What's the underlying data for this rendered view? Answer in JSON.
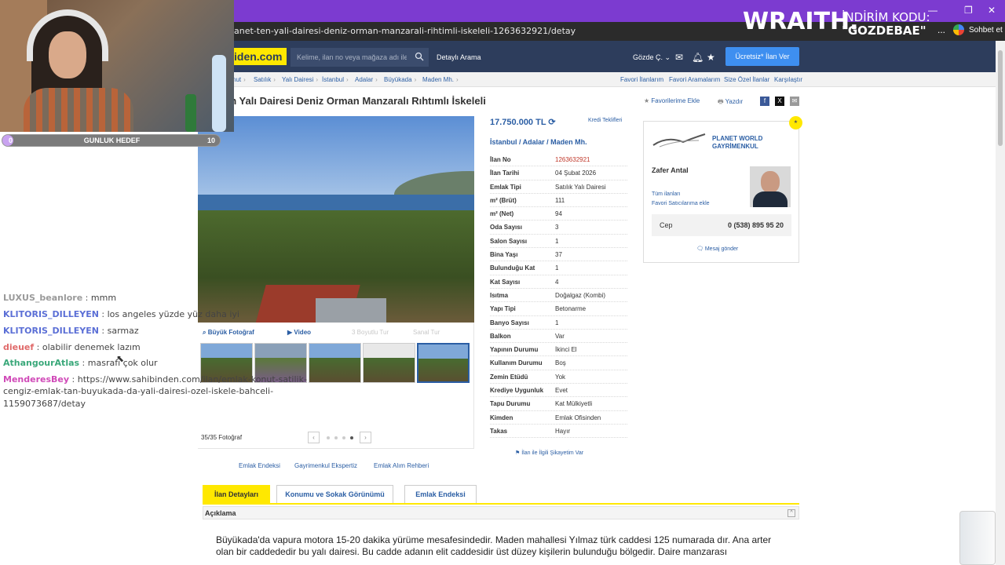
{
  "browser": {
    "url": "anet-ten-yali-dairesi-deniz-orman-manzarali-rihtimli-iskeleli-1263632921/detay",
    "more_label": "...",
    "chat_label": "Sohbet et"
  },
  "promo": {
    "brand": "WRAITH.",
    "line1": "İNDİRİM KODU:",
    "line2": "\"GOZDEBAE\""
  },
  "site": {
    "logo": "iden.com",
    "search_placeholder": "Kelime, ilan no veya mağaza adı ile ara",
    "advanced_search": "Detaylı Arama",
    "user_name": "Gözde Ç.",
    "post_button": "Ücretsiz* İlan Ver"
  },
  "breadcrumbs": [
    "nut",
    "Satılık",
    "Yalı Dairesi",
    "İstanbul",
    "Adalar",
    "Büyükada",
    "Maden Mh."
  ],
  "right_links": [
    "Favori İlanlarım",
    "Favori Aramalarım",
    "Size Özel İlanlar",
    "Karşılaştır"
  ],
  "listing": {
    "title": "en Yalı Dairesi Deniz Orman Manzaralı Rıhtımlı İskeleli",
    "favorite": "Favorilerime Ekle",
    "print": "Yazdır",
    "price": "17.750.000 TL",
    "loan": "Kredi Teklifleri",
    "location": "İstanbul  /  Adalar  /  Maden Mh.",
    "complain": "İlan ile İlgili Şikayetim Var"
  },
  "photo_bar": {
    "big_photo": "Büyük Fotoğraf",
    "video": "Video",
    "disabled1": "3 Boyutlu Tur",
    "disabled2": "Sanal Tur",
    "count": "35/35 Fotoğraf"
  },
  "info": [
    {
      "k": "İlan No",
      "v": "1263632921"
    },
    {
      "k": "İlan Tarihi",
      "v": "04 Şubat 2026"
    },
    {
      "k": "Emlak Tipi",
      "v": "Satılık Yalı Dairesi"
    },
    {
      "k": "m² (Brüt)",
      "v": "111"
    },
    {
      "k": "m² (Net)",
      "v": "94"
    },
    {
      "k": "Oda Sayısı",
      "v": "3"
    },
    {
      "k": "Salon Sayısı",
      "v": "1"
    },
    {
      "k": "Bina Yaşı",
      "v": "37"
    },
    {
      "k": "Bulunduğu Kat",
      "v": "1"
    },
    {
      "k": "Kat Sayısı",
      "v": "4"
    },
    {
      "k": "Isıtma",
      "v": "Doğalgaz (Kombi)"
    },
    {
      "k": "Yapı Tipi",
      "v": "Betonarme"
    },
    {
      "k": "Banyo Sayısı",
      "v": "1"
    },
    {
      "k": "Balkon",
      "v": "Var"
    },
    {
      "k": "Yapının Durumu",
      "v": "İkinci El"
    },
    {
      "k": "Kullanım Durumu",
      "v": "Boş"
    },
    {
      "k": "Zemin Etüdü",
      "v": "Yok"
    },
    {
      "k": "Krediye Uygunluk",
      "v": "Evet"
    },
    {
      "k": "Tapu Durumu",
      "v": "Kat Mülkiyetli"
    },
    {
      "k": "Kimden",
      "v": "Emlak Ofisinden"
    },
    {
      "k": "Takas",
      "v": "Hayır"
    }
  ],
  "seller": {
    "brand": "PLANET WORLD\nGAYRİMENKUL",
    "name": "Zafer Antal",
    "all_listings": "Tüm ilanları",
    "fav_seller": "Favori Satıcılarıma ekle",
    "phone_label": "Cep",
    "phone": "0 (538) 895 95 20",
    "message": "Mesaj gönder"
  },
  "below_links": [
    "Emlak Endeksi",
    "Gayrimenkul Ekspertiz",
    "Emlak Alım Rehberi"
  ],
  "tabs": [
    "İlan Detayları",
    "Konumu ve Sokak Görünümü",
    "Emlak Endeksi"
  ],
  "description": {
    "header": "Açıklama",
    "text": "Büyükada'da vapura motora 15-20 dakika yürüme mesafesindedir. Maden mahallesi Yılmaz türk caddesi 125 numarada dır. Ana arter olan bir caddededir bu yalı dairesi. Bu cadde adanın elit caddesidir üst düzey kişilerin bulunduğu bölgedir. Daire manzarası"
  },
  "stream": {
    "goal_min": "0",
    "goal_title": "GUNLUK HEDEF",
    "goal_max": "10",
    "goal_progress": 0.05
  },
  "chat": [
    {
      "user": "LUXUS_beanlore",
      "sep": " : ",
      "msg": "mmm",
      "color": "#9a9a9a"
    },
    {
      "user": "KLITORIS_DILLEYEN",
      "sep": " : ",
      "msg": "los angeles yüzde yüz daha iyi",
      "color": "#5b6fd6"
    },
    {
      "user": "KLITORIS_DILLEYEN",
      "sep": " : ",
      "msg": "sarmaz",
      "color": "#5b6fd6"
    },
    {
      "user": "dieuef",
      "sep": " : ",
      "msg": "olabilir denemek lazım",
      "color": "#e06a6a"
    },
    {
      "user": "AthangourAtlas",
      "sep": " : ",
      "msg": "masrafı çok olur",
      "color": "#3aa87a"
    },
    {
      "user": "MenderesBey",
      "sep": " : ",
      "msg": "https://www.sahibinden.com/ilan/emlak-konut-satilik-",
      "color": "#d04ab8"
    },
    {
      "user": "",
      "sep": "",
      "msg": "cengiz-emlak-tan-buyukada-da-yali-dairesi-ozel-iskele-bahceli-",
      "color": "#444444"
    },
    {
      "user": "",
      "sep": "",
      "msg": "1159073687/detay",
      "color": "#444444"
    }
  ]
}
